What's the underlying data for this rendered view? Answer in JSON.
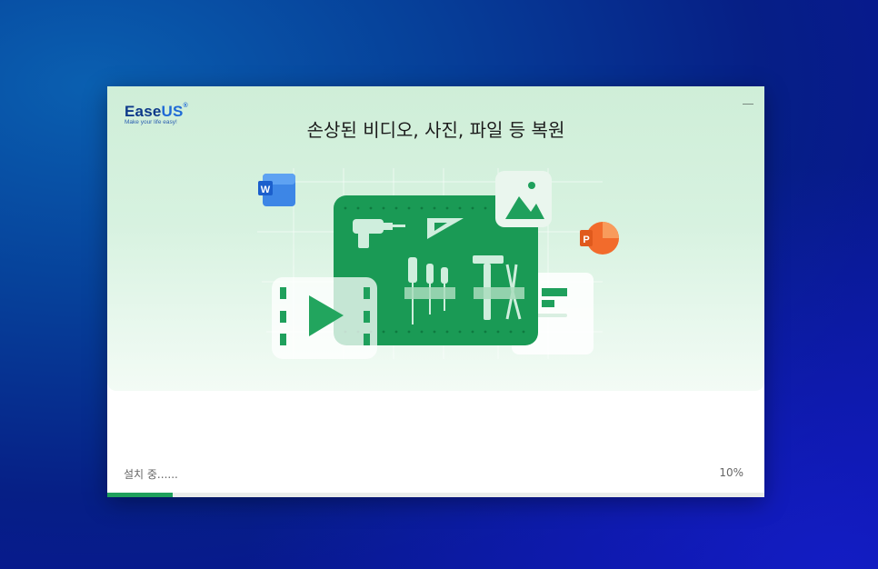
{
  "window": {
    "brand": {
      "name_part1": "Ease",
      "name_part2": "US",
      "registered": "®",
      "tagline": "Make your life easy!"
    },
    "title": "손상된 비디오, 사진, 파일 등 복원",
    "minimize_icon": "minimize-icon"
  },
  "illustration": {
    "icons": [
      "word-icon",
      "image-icon",
      "powerpoint-icon",
      "video-play-icon",
      "toolboard-icon",
      "drill-icon",
      "ruler-icon",
      "screwdriver-icon",
      "hammer-icon",
      "pliers-icon"
    ]
  },
  "install": {
    "status": "설치 중......",
    "percent_label": "10%",
    "progress": 0.1
  },
  "colors": {
    "accent": "#1fa05c",
    "hero_bg": "#d7f2e0",
    "logo_blue": "#0e3a8a"
  }
}
